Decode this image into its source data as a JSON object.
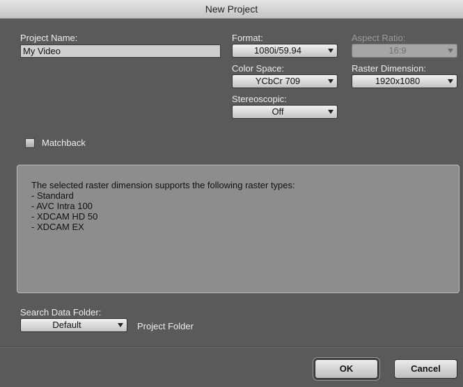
{
  "window": {
    "title": "New Project"
  },
  "project_name": {
    "label": "Project Name:",
    "value": "My Video"
  },
  "format": {
    "label": "Format:",
    "value": "1080i/59.94"
  },
  "aspect_ratio": {
    "label": "Aspect Ratio:",
    "value": "16:9"
  },
  "color_space": {
    "label": "Color Space:",
    "value": "YCbCr 709"
  },
  "raster_dimension": {
    "label": "Raster Dimension:",
    "value": "1920x1080"
  },
  "stereoscopic": {
    "label": "Stereoscopic:",
    "value": "Off"
  },
  "matchback": {
    "label": "Matchback",
    "checked": false
  },
  "info": {
    "lines": [
      "The selected raster dimension supports the following raster types:",
      " - Standard",
      " - AVC Intra 100",
      " - XDCAM HD 50",
      " - XDCAM EX"
    ]
  },
  "search_data_folder": {
    "label": "Search Data Folder:",
    "value": "Default",
    "side_label": "Project Folder"
  },
  "buttons": {
    "ok": "OK",
    "cancel": "Cancel"
  },
  "icons": {
    "dropdown": "chevron-down-icon",
    "checkbox": "checkbox-icon"
  }
}
